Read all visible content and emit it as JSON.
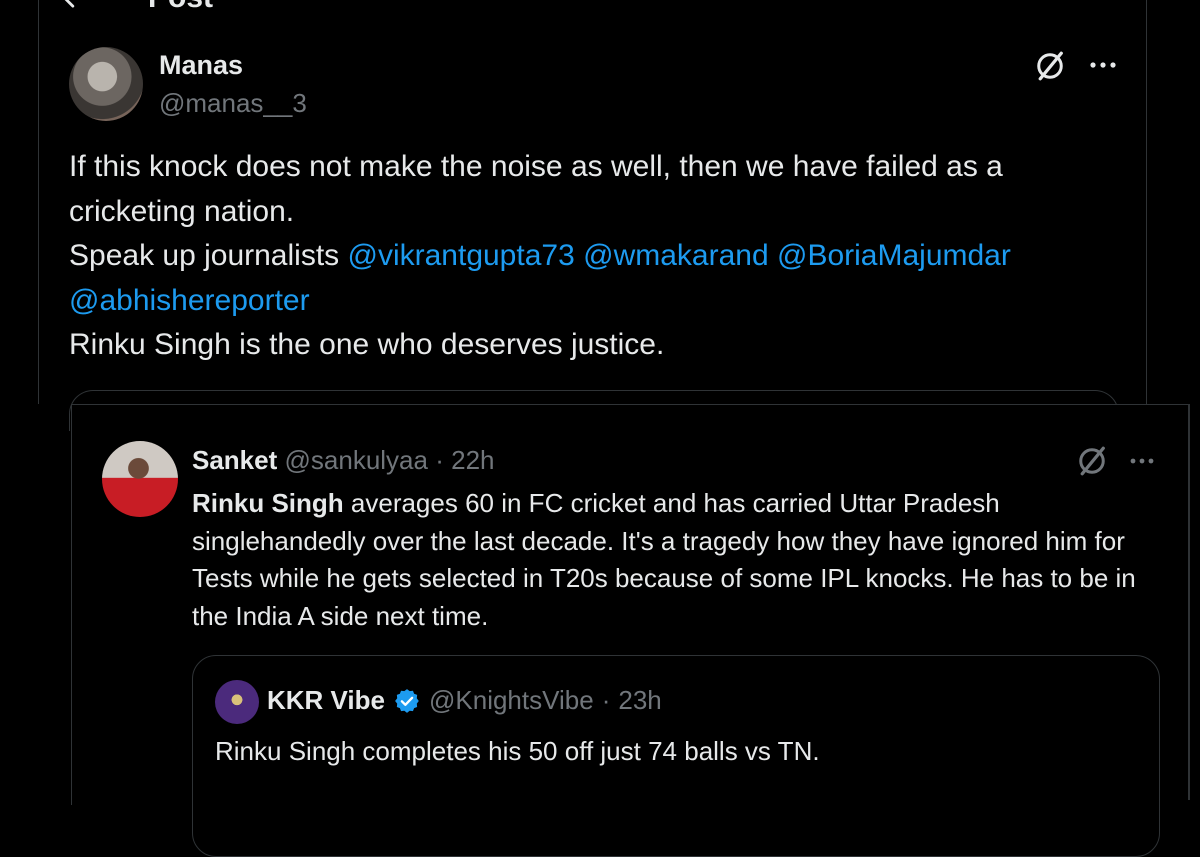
{
  "header": {
    "title": "Post",
    "back_icon": "arrow-left-icon"
  },
  "post": {
    "author": {
      "name": "Manas",
      "handle": "@manas__3"
    },
    "icons": {
      "grok": "grok-slash-icon",
      "more": "more-dots-icon"
    },
    "text_line_1": "If this knock does not make the noise as well, then we have failed as a cricketing nation.",
    "text_line_2_prefix": "Speak up journalists ",
    "mentions": [
      "@vikrantgupta73",
      "@wmakarand",
      "@BoriaMajumdar",
      "@abhishereporter"
    ],
    "text_line_3": "Rinku Singh is the one who deserves justice."
  },
  "quoted": {
    "author": {
      "name": "Sanket",
      "handle": "@sankulyaa",
      "time": "22h",
      "separator": "·"
    },
    "text_bold": "Rinku Singh",
    "text_rest": " averages 60 in FC cricket and has carried Uttar Pradesh singlehandedly over the last decade. It's a tragedy how they have ignored him for Tests while he gets selected in T20s because of some IPL knocks. He has to be in the India A side next time.",
    "nested": {
      "author": {
        "name": "KKR Vibe",
        "handle": "@KnightsVibe",
        "time": "23h",
        "separator": "·"
      },
      "text": "Rinku Singh completes his 50 off just 74 balls vs TN."
    }
  },
  "colors": {
    "background": "#000000",
    "text": "#e7e9ea",
    "muted": "#71767b",
    "link": "#1d9bf0",
    "border": "#2f3336"
  }
}
